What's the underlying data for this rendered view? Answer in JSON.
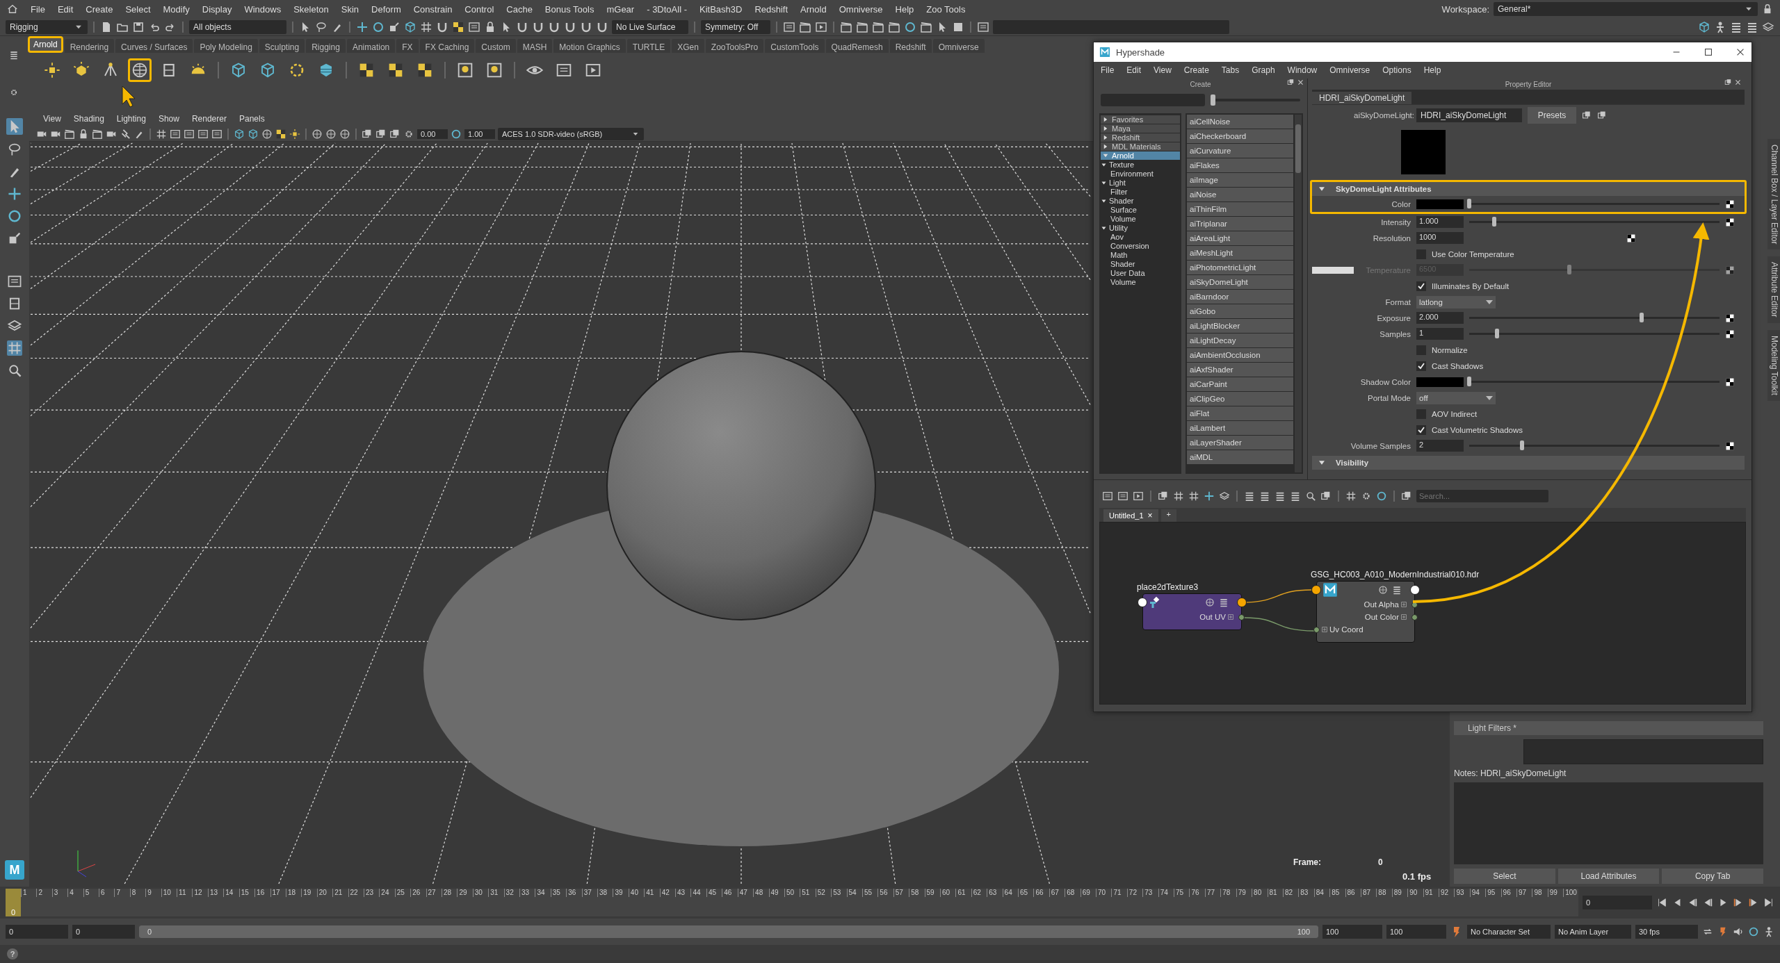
{
  "menu_bar": {
    "items": [
      "File",
      "Edit",
      "Create",
      "Select",
      "Modify",
      "Display",
      "Windows",
      "Skeleton",
      "Skin",
      "Deform",
      "Constrain",
      "Control",
      "Cache",
      "Bonus Tools",
      "mGear",
      "- 3DtoAll -",
      "KitBash3D",
      "Redshift",
      "Arnold",
      "Omniverse",
      "Help",
      "Zoo Tools"
    ]
  },
  "workspace": {
    "label": "Workspace:",
    "value": "General*"
  },
  "status_line": {
    "menu_set": "Rigging",
    "selection_mask": "All objects",
    "live_surface": "No Live Surface",
    "symmetry": "Symmetry: Off"
  },
  "shelf": {
    "tabs": [
      {
        "label": "Arnold",
        "selected": true,
        "highlighted": true
      },
      {
        "label": "Rendering",
        "selected": false,
        "highlighted": false
      },
      {
        "label": "Curves / Surfaces",
        "selected": false,
        "highlighted": false
      },
      {
        "label": "Poly Modeling",
        "selected": false,
        "highlighted": false
      },
      {
        "label": "Sculpting",
        "selected": false,
        "highlighted": false
      },
      {
        "label": "Rigging",
        "selected": false,
        "highlighted": false
      },
      {
        "label": "Animation",
        "selected": false,
        "highlighted": false
      },
      {
        "label": "FX",
        "selected": false,
        "highlighted": false
      },
      {
        "label": "FX Caching",
        "selected": false,
        "highlighted": false
      },
      {
        "label": "Custom",
        "selected": false,
        "highlighted": false
      },
      {
        "label": "MASH",
        "selected": false,
        "highlighted": false
      },
      {
        "label": "Motion Graphics",
        "selected": false,
        "highlighted": false
      },
      {
        "label": "TURTLE",
        "selected": false,
        "highlighted": false
      },
      {
        "label": "XGen",
        "selected": false,
        "highlighted": false
      },
      {
        "label": "ZooToolsPro",
        "selected": false,
        "highlighted": false
      },
      {
        "label": "CustomTools",
        "selected": false,
        "highlighted": false
      },
      {
        "label": "QuadRemesh",
        "selected": false,
        "highlighted": false
      },
      {
        "label": "Redshift",
        "selected": false,
        "highlighted": false
      },
      {
        "label": "Omniverse",
        "selected": false,
        "highlighted": false
      }
    ],
    "buttons": [
      {
        "kind": "light",
        "highlighted": false
      },
      {
        "kind": "cube-light",
        "highlighted": false
      },
      {
        "kind": "spot",
        "highlighted": false
      },
      {
        "kind": "dome",
        "highlighted": true
      },
      {
        "kind": "portal",
        "highlighted": false
      },
      {
        "kind": "sky",
        "highlighted": false
      },
      {
        "kind": "cube",
        "highlighted": false
      },
      {
        "kind": "cube",
        "highlighted": false
      },
      {
        "kind": "curve",
        "highlighted": false
      },
      {
        "kind": "volume",
        "highlighted": false
      },
      {
        "kind": "checker",
        "highlighted": false
      },
      {
        "kind": "checker",
        "highlighted": false
      },
      {
        "kind": "checker",
        "highlighted": false
      },
      {
        "kind": "shader",
        "highlighted": false
      },
      {
        "kind": "shader",
        "highlighted": false
      },
      {
        "kind": "eye",
        "highlighted": false
      },
      {
        "kind": "window",
        "highlighted": false
      },
      {
        "kind": "play",
        "highlighted": false
      }
    ]
  },
  "viewport": {
    "menus": [
      "View",
      "Shading",
      "Lighting",
      "Show",
      "Renderer",
      "Panels"
    ],
    "exposure": "0.00",
    "gamma": "1.00",
    "color_space": "ACES 1.0 SDR-video (sRGB)",
    "hud_frame_label": "Frame:",
    "hud_frame": "0",
    "hud_fps": "0.1 fps"
  },
  "hypershade": {
    "title": "Hypershade",
    "menus": [
      "File",
      "Edit",
      "View",
      "Create",
      "Tabs",
      "Graph",
      "Window",
      "Omniverse",
      "Options",
      "Help"
    ],
    "create_panel": {
      "title": "Create",
      "categories": [
        {
          "label": "Favorites",
          "expanded": false,
          "selected": false
        },
        {
          "label": "Maya",
          "expanded": false,
          "selected": false
        },
        {
          "label": "Redshift",
          "expanded": false,
          "selected": false
        },
        {
          "label": "MDL Materials",
          "expanded": false,
          "selected": false
        },
        {
          "label": "Arnold",
          "expanded": true,
          "selected": true,
          "children": [
            {
              "label": "Texture",
              "expanded": true,
              "selected": false,
              "children": [
                {
                  "label": "Environment",
                  "selected": false
                }
              ]
            },
            {
              "label": "Light",
              "expanded": true,
              "selected": false,
              "children": [
                {
                  "label": "Filter",
                  "selected": false
                }
              ]
            },
            {
              "label": "Shader",
              "expanded": true,
              "selected": false,
              "children": [
                {
                  "label": "Surface",
                  "selected": false
                },
                {
                  "label": "Volume",
                  "selected": false
                }
              ]
            },
            {
              "label": "Utility",
              "expanded": true,
              "selected": false,
              "children": [
                {
                  "label": "Aov",
                  "selected": false
                },
                {
                  "label": "Conversion",
                  "selected": false
                },
                {
                  "label": "Math",
                  "selected": false
                },
                {
                  "label": "Shader",
                  "selected": false
                },
                {
                  "label": "User Data",
                  "selected": false
                },
                {
                  "label": "Volume",
                  "selected": false
                }
              ]
            }
          ]
        }
      ],
      "nodes": [
        "aiCellNoise",
        "aiCheckerboard",
        "aiCurvature",
        "aiFlakes",
        "aiImage",
        "aiNoise",
        "aiThinFilm",
        "aiTriplanar",
        "aiAreaLight",
        "aiMeshLight",
        "aiPhotometricLight",
        "aiSkyDomeLight",
        "aiBarndoor",
        "aiGobo",
        "aiLightBlocker",
        "aiLightDecay",
        "aiAmbientOcclusion",
        "aiAxfShader",
        "aiCarPaint",
        "aiClipGeo",
        "aiFlat",
        "aiLambert",
        "aiLayerShader",
        "aiMDL"
      ]
    },
    "property_editor": {
      "title": "Property Editor",
      "tab": "HDRI_aiSkyDomeLight",
      "type_label": "aiSkyDomeLight:",
      "name": "HDRI_aiSkyDomeLight",
      "presets": "Presets",
      "sections": [
        {
          "title": "SkyDomeLight Attributes",
          "expanded": true,
          "highlighted": true,
          "rows": [
            {
              "kind": "color",
              "label": "Color",
              "level": 0.0
            },
            {
              "kind": "slider",
              "label": "Intensity",
              "value": "1.000",
              "level": 0.1
            },
            {
              "kind": "field",
              "label": "Resolution",
              "value": "1000"
            },
            {
              "kind": "checkbox",
              "label": "Use Color Temperature",
              "checked": false
            },
            {
              "kind": "temperature",
              "label": "Temperature",
              "value": "6500",
              "level": 0.4
            },
            {
              "kind": "checkbox",
              "label": "Illuminates By Default",
              "checked": true
            },
            {
              "kind": "dropdown",
              "label": "Format",
              "value": "latlong"
            },
            {
              "kind": "slider",
              "label": "Exposure",
              "value": "2.000",
              "level": 0.69
            },
            {
              "kind": "slider",
              "label": "Samples",
              "value": "1",
              "level": 0.11
            },
            {
              "kind": "checkbox",
              "label": "Normalize",
              "checked": false
            },
            {
              "kind": "checkbox",
              "label": "Cast Shadows",
              "checked": true
            },
            {
              "kind": "color",
              "label": "Shadow Color",
              "level": 0.0
            },
            {
              "kind": "dropdown",
              "label": "Portal Mode",
              "value": "off"
            },
            {
              "kind": "checkbox",
              "label": "AOV Indirect",
              "checked": false
            },
            {
              "kind": "checkbox",
              "label": "Cast Volumetric Shadows",
              "checked": true
            },
            {
              "kind": "slider",
              "label": "Volume Samples",
              "value": "2",
              "level": 0.21
            }
          ]
        },
        {
          "title": "Visibility",
          "expanded": true,
          "highlighted": false
        }
      ]
    },
    "node_editor": {
      "search_placeholder": "Search...",
      "tabs": [
        {
          "label": "Untitled_1",
          "selected": true,
          "close": "×"
        }
      ],
      "add_tab": "+",
      "nodes": [
        {
          "kind": "place2d",
          "title": "place2dTexture3",
          "ports": [
            {
              "kind": "out",
              "label": "Out UV"
            }
          ]
        },
        {
          "kind": "file",
          "title": "GSG_HC003_A010_ModernIndustrial010.hdr",
          "ports": [
            {
              "kind": "out",
              "label": "Out Alpha"
            },
            {
              "kind": "out",
              "label": "Out Color"
            },
            {
              "kind": "in",
              "label": "Uv Coord"
            }
          ]
        }
      ]
    }
  },
  "attribute_editor": {
    "section": "Light Filters *",
    "notes_label": "Notes:",
    "notes_value": "HDRI_aiSkyDomeLight",
    "buttons": [
      "Select",
      "Load Attributes",
      "Copy Tab"
    ]
  },
  "side_tabs": [
    "Channel Box / Layer Editor",
    "Attribute Editor",
    "Modeling Toolkit"
  ],
  "logo": "M",
  "timeline": {
    "level": 0,
    "current": "0",
    "current_field": "0",
    "frames": [
      "1",
      "2",
      "3",
      "4",
      "5",
      "6",
      "7",
      "8",
      "9",
      "10",
      "11",
      "12",
      "13",
      "14",
      "15",
      "16",
      "17",
      "18",
      "19",
      "20",
      "21",
      "22",
      "23",
      "24",
      "25",
      "26",
      "27",
      "28",
      "29",
      "30",
      "31",
      "32",
      "33",
      "34",
      "35",
      "36",
      "37",
      "38",
      "39",
      "40",
      "41",
      "42",
      "43",
      "44",
      "45",
      "46",
      "47",
      "48",
      "49",
      "50",
      "51",
      "52",
      "53",
      "54",
      "55",
      "56",
      "57",
      "58",
      "59",
      "60",
      "61",
      "62",
      "63",
      "64",
      "65",
      "66",
      "67",
      "68",
      "69",
      "70",
      "71",
      "72",
      "73",
      "74",
      "75",
      "76",
      "77",
      "78",
      "79",
      "80",
      "81",
      "82",
      "83",
      "84",
      "85",
      "86",
      "87",
      "88",
      "89",
      "90",
      "91",
      "92",
      "93",
      "94",
      "95",
      "96",
      "97",
      "98",
      "99",
      "100"
    ]
  },
  "range_slider": {
    "level": 1,
    "start": "0",
    "anim_start": "0",
    "range_start": "0",
    "range_end": "100",
    "anim_end": "100",
    "end": "100",
    "character_set": "No Character Set",
    "anim_layer": "No Anim Layer",
    "fps": "30 fps"
  },
  "help_line": {
    "icon": "?"
  }
}
